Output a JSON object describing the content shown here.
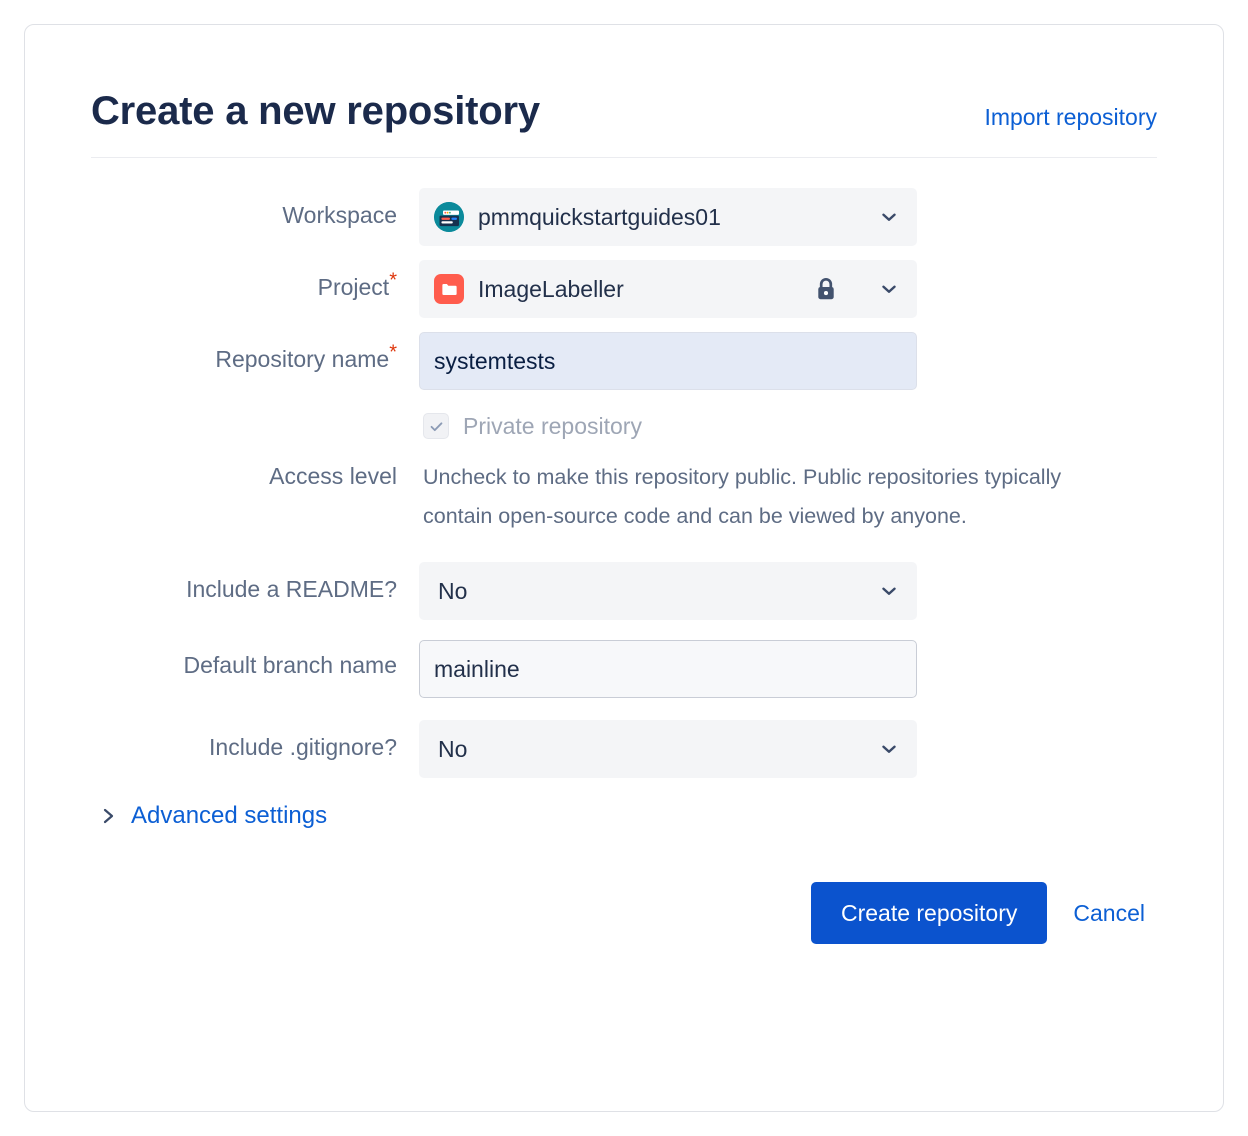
{
  "header": {
    "title": "Create a new repository",
    "import_link": "Import repository"
  },
  "form": {
    "workspace": {
      "label": "Workspace",
      "value": "pmmquickstartguides01",
      "avatar_icon": "workspace-avatar-icon",
      "chevron_icon": "chevron-down-icon"
    },
    "project": {
      "label": "Project",
      "required_mark": "*",
      "value": "ImageLabeller",
      "avatar_icon": "project-folder-icon",
      "lock_icon": "lock-icon",
      "chevron_icon": "chevron-down-icon"
    },
    "repository_name": {
      "label": "Repository name",
      "required_mark": "*",
      "value": "systemtests",
      "placeholder": ""
    },
    "access_level": {
      "label": "Access level",
      "checkbox_label": "Private repository",
      "checked": true,
      "disabled": true,
      "check_icon": "checkmark-icon",
      "help_text": "Uncheck to make this repository public. Public repositories typically contain open-source code and can be viewed by anyone."
    },
    "include_readme": {
      "label": "Include a README?",
      "value": "No",
      "chevron_icon": "chevron-down-icon"
    },
    "default_branch": {
      "label": "Default branch name",
      "value": "mainline",
      "placeholder": ""
    },
    "include_gitignore": {
      "label": "Include .gitignore?",
      "value": "No",
      "chevron_icon": "chevron-down-icon"
    },
    "advanced_settings": {
      "label": "Advanced settings",
      "chevron_icon": "chevron-right-icon",
      "expanded": false
    }
  },
  "footer": {
    "create_label": "Create repository",
    "cancel_label": "Cancel"
  },
  "colors": {
    "accent_blue": "#0B53CE",
    "link_blue": "#0C5FD4",
    "title_navy": "#1B2A4B",
    "label_gray": "#5E6C84",
    "required_red": "#DE350B",
    "project_red": "#FF5C4D",
    "workspace_teal": "#0B8A9B",
    "field_gray": "#F4F5F7",
    "focus_blue_bg": "#E4EAF6",
    "card_border": "#DFE1E6"
  }
}
